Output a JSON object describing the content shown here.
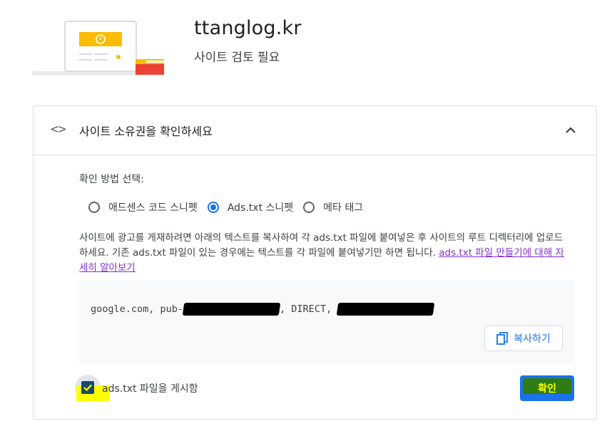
{
  "site": {
    "domain": "ttanglog.kr",
    "status": "사이트 검토 필요"
  },
  "card": {
    "header_icon": "code-brackets-icon",
    "title": "사이트 소유권을 확인하세요",
    "collapse_icon": "chevron-up-icon"
  },
  "method": {
    "label": "확인 방법 선택:",
    "options": [
      {
        "label": "애드센스 코드 스니펫",
        "checked": false
      },
      {
        "label": "Ads.txt 스니펫",
        "checked": true
      },
      {
        "label": "메타 태그",
        "checked": false
      }
    ]
  },
  "description": {
    "text": "사이트에 광고를 게재하려면 아래의 텍스트를 복사하여 각 ads.txt 파일에 붙여넣은 후 사이트의 루트 디렉터리에 업로드하세요. 기존 ads.txt 파일이 있는 경우에는 텍스트를 각 파일에 붙여넣기만 하면 됩니다.",
    "link": "ads.txt 파일 만들기에 대해 자세히 알아보기"
  },
  "snippet": {
    "part1": "google.com, pub-",
    "part2": ", DIRECT, ",
    "copy_label": "복사하기",
    "copy_icon": "copy-icon"
  },
  "confirm": {
    "checkbox_label": "ads.txt 파일을 게시함",
    "checked": true,
    "button_label": "확인"
  },
  "colors": {
    "accent": "#1a73e8",
    "link": "#8430ce",
    "highlight": "#ffff00",
    "highlight_green": "#2f7d12"
  }
}
